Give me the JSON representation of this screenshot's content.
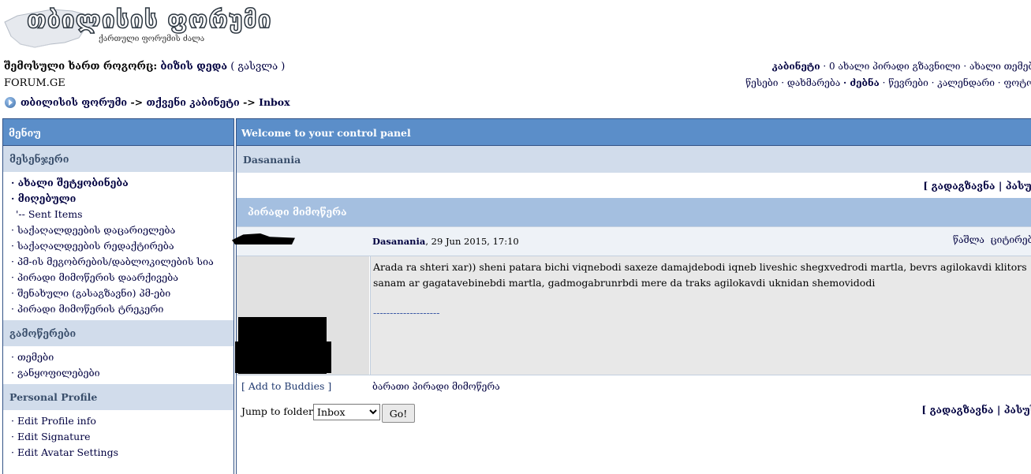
{
  "logo": {
    "title": "თბილისის ფორუმი",
    "subtitle": "ქართული ფორუმის ძალა"
  },
  "userbar": {
    "logged_in_as": "შემოსული ხართ როგორც:",
    "username": "ბიზის დედა",
    "logout": "( გასვლა )",
    "cabinet": "კაბინეტი",
    "new_pm": "· 0 ახალი პირადი გზავნილი",
    "new_topics": "· ახალი თემები"
  },
  "site_name": "FORUM.GE",
  "nav": {
    "rules": "წესები",
    "help": "· დახმარება",
    "search": "· ძებნა",
    "members": "· წევრები",
    "calendar": "· კალენდარი",
    "photo": "· ფოტო"
  },
  "breadcrumb": {
    "forum": "თბილისის ფორუმი",
    "sep1": " -> ",
    "cabinet": "თქვენი კაბინეტი",
    "sep2": " -> ",
    "current": "Inbox"
  },
  "menu": {
    "header": "მენიუ",
    "messenger": {
      "title": "მესენჯერი",
      "items": [
        "· ახალი შეტყობინება",
        "· მიღებული",
        "'-- Sent Items",
        "· საქაღალდეების დაცარიელება",
        "· საქაღალდეების რედაქტირება",
        "· პმ-ის მეგობრების/დაბლოკილების სია",
        "· პირადი მიმოწერის დაარქივება",
        "· შენახული (გასაგზავნი) პმ-ები",
        "· პირადი მიმოწერის ტრეკერი"
      ]
    },
    "subscriptions": {
      "title": "გამოწერები",
      "items": [
        "· თემები",
        "· განყოფილებები"
      ]
    },
    "profile": {
      "title": "Personal Profile",
      "items": [
        "· Edit Profile info",
        "· Edit Signature",
        "· Edit Avatar Settings"
      ]
    }
  },
  "panel": {
    "welcome": "Welcome to your control panel",
    "conversation_with": "Dasanania",
    "actions": "[ გადაგზავნა | პასუხი ]",
    "section": "პირადი მიმოწერა",
    "message": {
      "author": "Dasanania",
      "date": ", 29 Jun 2015, 17:10",
      "delete": "წაშლა",
      "quote": "ციტირება",
      "body": "Arada ra shteri xar)) sheni patara bichi viqnebodi saxeze damajdebodi iqneb liveshic shegxvedrodi martla, bevrs agilokavdi klitors sanam ar gagatavebinebdi martla, gadmogabrunrbdi mere da traks agilokavdi uknidan shemovidodi",
      "signature": "--------------------"
    },
    "add_buddies": "[ Add to Buddies ]",
    "back_pm": "ბარათი პირადი მიმოწერა",
    "jump_label": "Jump to folder:",
    "jump_selected": "Inbox",
    "go": "Go!",
    "actions_bottom": "[ გადაგზავნა | პასუხი ]"
  }
}
